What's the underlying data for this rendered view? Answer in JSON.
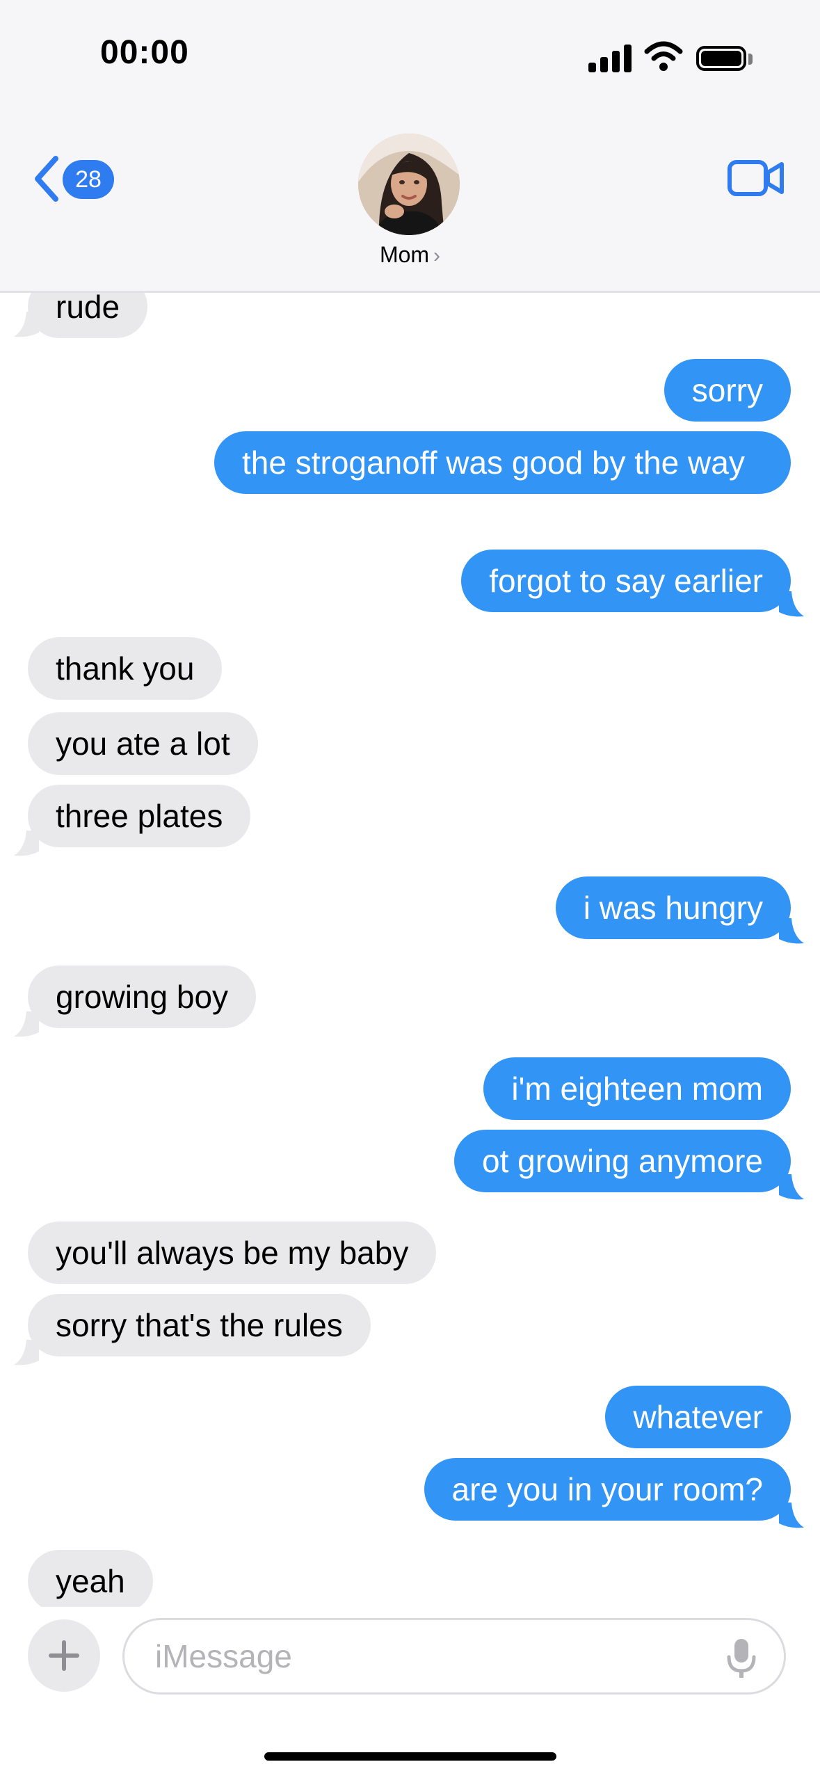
{
  "status_bar": {
    "time": "00:00"
  },
  "header": {
    "back_count": "28",
    "contact_name": "Mom"
  },
  "messages": [
    {
      "from": "them",
      "text": "rude"
    },
    {
      "from": "me",
      "text": "sorry"
    },
    {
      "from": "me",
      "text": "the stroganoff was good by the way"
    },
    {
      "from": "me",
      "text": "forgot to say earlier"
    },
    {
      "from": "them",
      "text": "thank you"
    },
    {
      "from": "them",
      "text": "you ate a lot"
    },
    {
      "from": "them",
      "text": "three plates"
    },
    {
      "from": "me",
      "text": "i was hungry"
    },
    {
      "from": "them",
      "text": "growing boy"
    },
    {
      "from": "me",
      "text": "i'm eighteen mom"
    },
    {
      "from": "me",
      "text": "ot growing anymore"
    },
    {
      "from": "them",
      "text": "you'll always be my baby"
    },
    {
      "from": "them",
      "text": "sorry that's the rules"
    },
    {
      "from": "me",
      "text": "whatever"
    },
    {
      "from": "me",
      "text": "are you in your room?"
    },
    {
      "from": "them",
      "text": "yeah"
    }
  ],
  "composer": {
    "placeholder": "iMessage"
  },
  "colors": {
    "outgoing": "#3294f5",
    "incoming": "#e9e9eb",
    "accent": "#2f7cf0"
  },
  "icons": [
    "back-chevron-icon",
    "video-call-icon",
    "plus-icon",
    "microphone-icon",
    "signal-icon",
    "wifi-icon",
    "battery-icon"
  ]
}
